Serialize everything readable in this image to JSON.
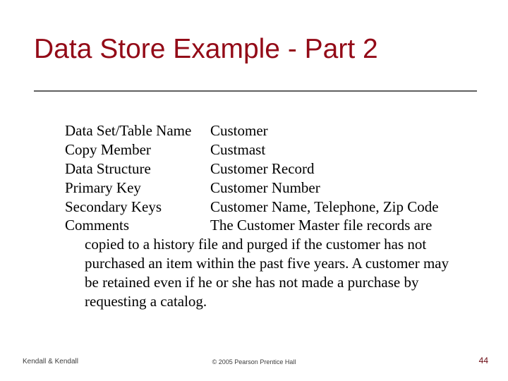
{
  "title": "Data Store Example - Part 2",
  "rows": {
    "r0": {
      "label": "Data Set/Table Name",
      "value": "Customer"
    },
    "r1": {
      "label": "Copy Member",
      "value": "Custmast"
    },
    "r2": {
      "label": "Data Structure",
      "value": "Customer Record"
    },
    "r3": {
      "label": "Primary Key",
      "value": "Customer Number"
    },
    "r4": {
      "label": "Secondary Keys",
      "value": "Customer Name, Telephone, Zip Code"
    }
  },
  "comments": {
    "label": "Comments",
    "first_value": "The Customer Master file records are",
    "rest": "copied to a history file and purged if the customer has not purchased an item within the past five years.  A customer may be retained even if he or she has not made a purchase by requesting a catalog."
  },
  "footer": {
    "left": "Kendall & Kendall",
    "center": "© 2005 Pearson Prentice Hall",
    "right": "44"
  }
}
